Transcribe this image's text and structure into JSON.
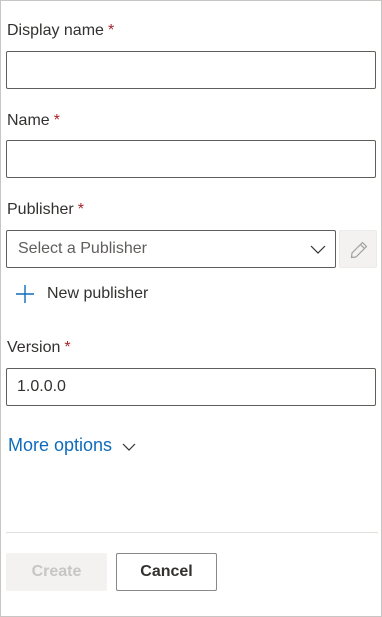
{
  "form": {
    "display_name": {
      "label": "Display name",
      "required_mark": "*",
      "value": ""
    },
    "name": {
      "label": "Name",
      "required_mark": "*",
      "value": ""
    },
    "publisher": {
      "label": "Publisher",
      "required_mark": "*",
      "placeholder": "Select a Publisher",
      "edit_icon": "pencil-icon",
      "dropdown_icon": "chevron-down-icon"
    },
    "new_publisher": {
      "label": "New publisher",
      "icon": "plus-icon"
    },
    "version": {
      "label": "Version",
      "required_mark": "*",
      "value": "1.0.0.0"
    },
    "more_options": {
      "label": "More options",
      "icon": "chevron-down-icon"
    }
  },
  "footer": {
    "create_label": "Create",
    "cancel_label": "Cancel"
  },
  "colors": {
    "link": "#0f6cbd",
    "required": "#a4262c",
    "border": "#605e5c",
    "disabled_bg": "#f3f2f1",
    "disabled_text": "#c8c6c4"
  }
}
